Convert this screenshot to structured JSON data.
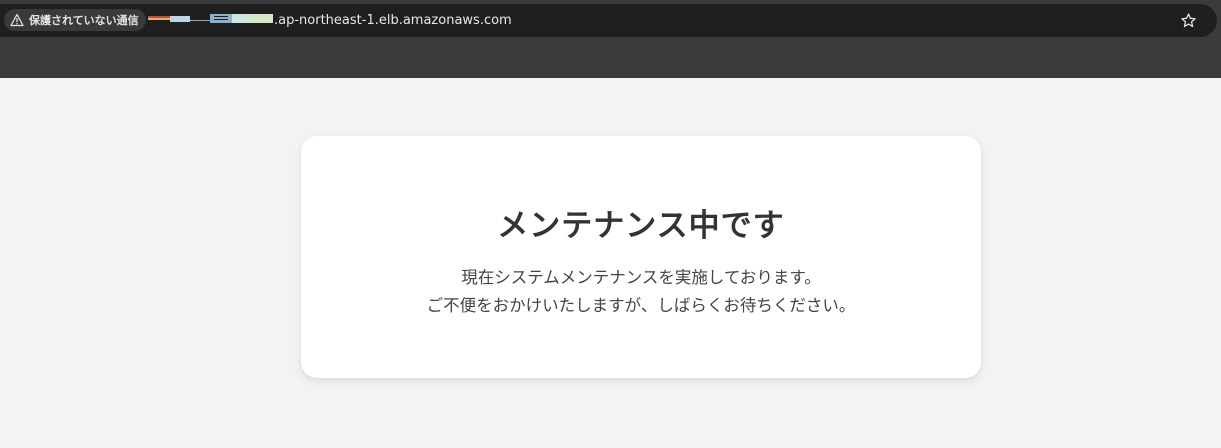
{
  "browser": {
    "security_label": "保護されていない通信",
    "url_suffix": ".ap-northeast-1.elb.amazonaws.com",
    "bookmark_icon": "star-icon",
    "warning_icon": "warning-icon",
    "chrome_color": "#3b3b3b",
    "omnibox_color": "#1f1f1f"
  },
  "page": {
    "background_color": "#f2f3f5",
    "card": {
      "title": "メンテナンス中です",
      "message_line1": "現在システムメンテナンスを実施しております。",
      "message_line2": "ご不便をおかけいたしますが、しばらくお待ちください。"
    }
  }
}
